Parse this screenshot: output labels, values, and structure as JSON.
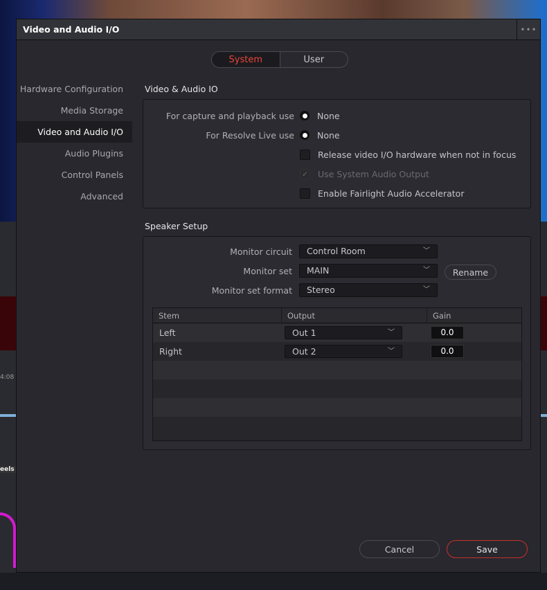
{
  "window": {
    "title": "Video and Audio I/O",
    "more_icon": "ellipsis-icon"
  },
  "tabs": [
    {
      "label": "System",
      "active": true
    },
    {
      "label": "User",
      "active": false
    }
  ],
  "sidebar": {
    "items": [
      {
        "label": "Hardware Configuration"
      },
      {
        "label": "Media Storage"
      },
      {
        "label": "Video and Audio I/O",
        "active": true
      },
      {
        "label": "Audio Plugins"
      },
      {
        "label": "Control Panels"
      },
      {
        "label": "Advanced"
      }
    ]
  },
  "video_audio_io": {
    "heading": "Video & Audio IO",
    "capture_label": "For capture and playback use",
    "capture_value": "None",
    "live_label": "For Resolve Live use",
    "live_value": "None",
    "release_label": "Release video I/O hardware when not in focus",
    "release_checked": false,
    "system_audio_label": "Use System Audio Output",
    "system_audio_checked": true,
    "system_audio_disabled": true,
    "fairlight_label": "Enable Fairlight Audio Accelerator",
    "fairlight_checked": false
  },
  "speaker_setup": {
    "heading": "Speaker Setup",
    "monitor_circuit_label": "Monitor circuit",
    "monitor_circuit_value": "Control Room",
    "monitor_set_label": "Monitor set",
    "monitor_set_value": "MAIN",
    "rename_label": "Rename",
    "format_label": "Monitor set format",
    "format_value": "Stereo",
    "table": {
      "headers": [
        "Stem",
        "Output",
        "Gain"
      ],
      "rows": [
        {
          "stem": "Left",
          "output": "Out 1",
          "gain": "0.0"
        },
        {
          "stem": "Right",
          "output": "Out 2",
          "gain": "0.0"
        }
      ]
    }
  },
  "footer": {
    "cancel_label": "Cancel",
    "save_label": "Save"
  },
  "background": {
    "timecode": "4:08",
    "panel_label": "eels"
  },
  "colors": {
    "accent": "#e8453c",
    "dialog_bg": "#28282e"
  }
}
